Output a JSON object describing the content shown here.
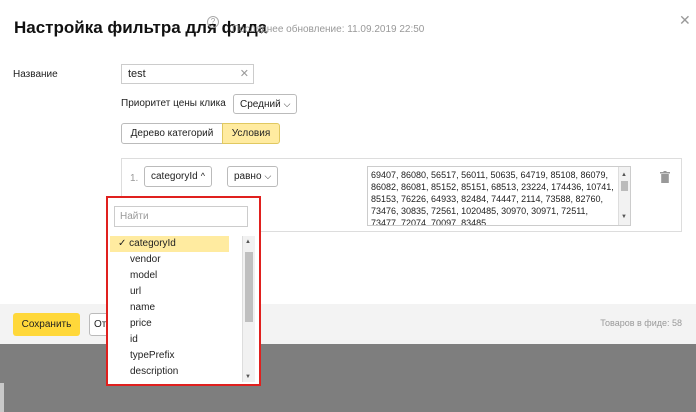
{
  "header": {
    "title": "Настройка фильтра для фида",
    "updated": "Последнее обновление: 11.09.2019 22:50"
  },
  "form": {
    "name_label": "Название",
    "name_value": "test",
    "priority_label": "Приоритет цены клика",
    "priority_value": "Средний",
    "tabs": [
      {
        "label": "Дерево категорий",
        "active": false
      },
      {
        "label": "Условия",
        "active": true
      }
    ]
  },
  "condition": {
    "number": "1.",
    "field": "categoryId",
    "operator": "равно",
    "values": "69407, 86080, 56517, 56011, 50635, 64719, 85108, 86079, 86082, 86081, 85152, 85151, 68513, 23224, 174436, 10741, 85153, 76226, 64933, 82484, 74447, 2114, 73588, 82760, 73476, 30835, 72561, 1020485, 30970, 30971, 72511, 73477, 72074, 70097, 83485,"
  },
  "dropdown": {
    "search_placeholder": "Найти",
    "selected_mark": "✓",
    "items": [
      "categoryId",
      "vendor",
      "model",
      "url",
      "name",
      "price",
      "id",
      "typePrefix",
      "description"
    ]
  },
  "footer": {
    "save_label": "Сохранить",
    "cancel_label": "Отмена",
    "items_count": "Товаров в фиде: 58"
  },
  "colors": {
    "accent": "#ffd83a",
    "selected_bg": "#ffeba0",
    "highlight_border": "#e0201e"
  }
}
